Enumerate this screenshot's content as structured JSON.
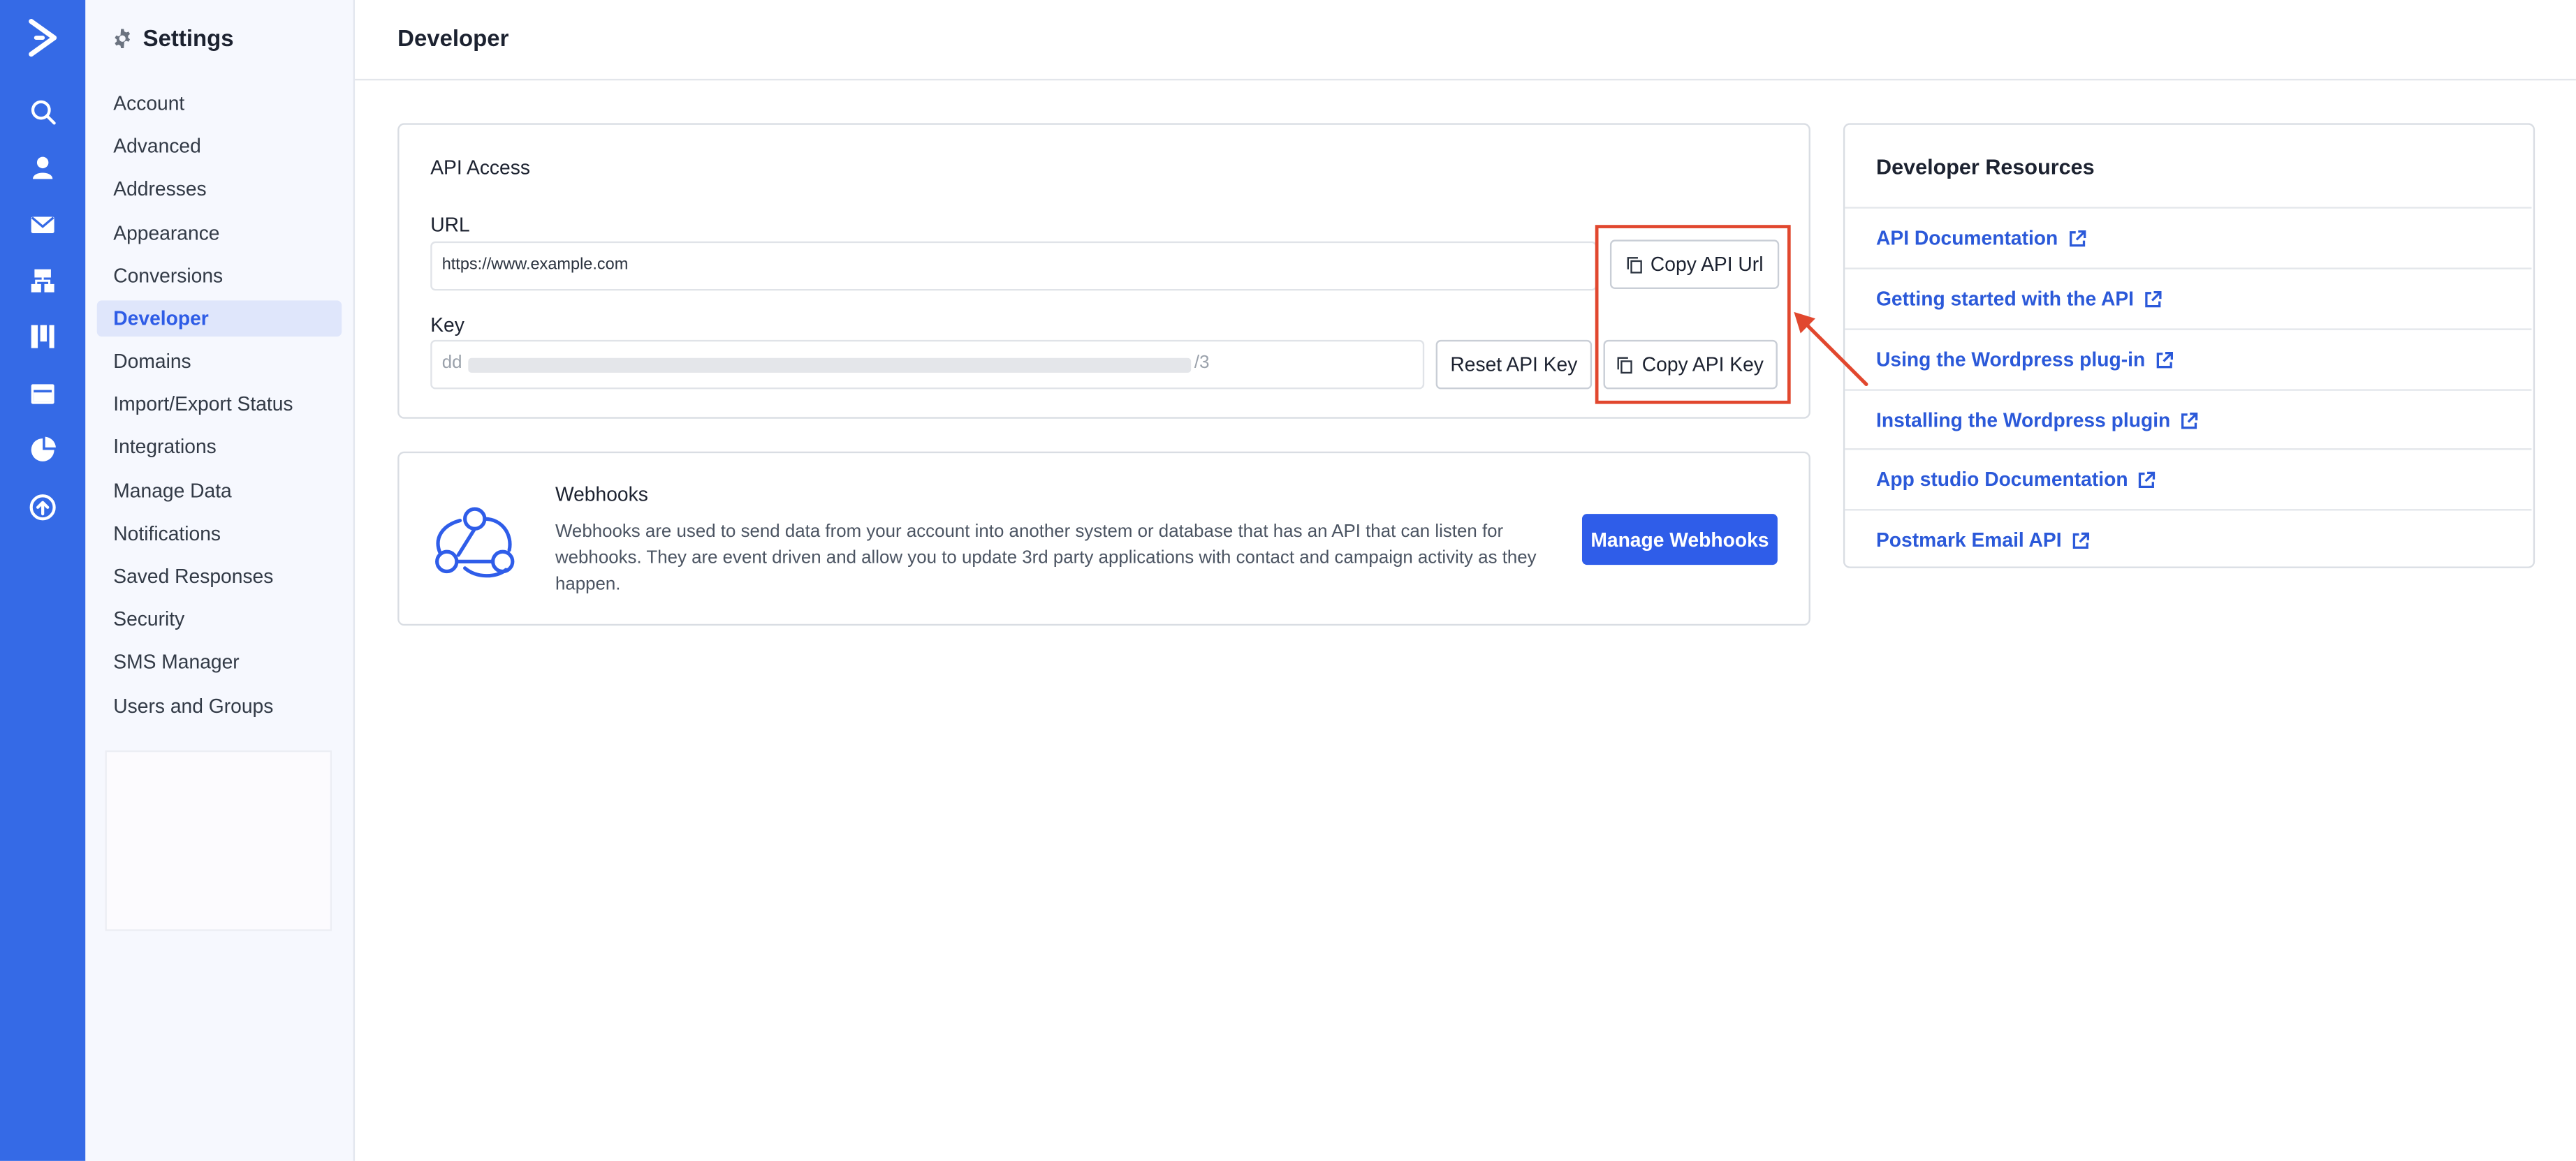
{
  "nav_rail": {
    "icons": [
      "logo-icon",
      "search-icon",
      "contacts-icon",
      "campaigns-icon",
      "automations-icon",
      "deals-icon",
      "website-icon",
      "reports-icon",
      "upgrade-icon"
    ]
  },
  "settings": {
    "title": "Settings",
    "items": [
      {
        "label": "Account"
      },
      {
        "label": "Advanced"
      },
      {
        "label": "Addresses"
      },
      {
        "label": "Appearance"
      },
      {
        "label": "Conversions"
      },
      {
        "label": "Developer",
        "active": true
      },
      {
        "label": "Domains"
      },
      {
        "label": "Import/Export Status"
      },
      {
        "label": "Integrations"
      },
      {
        "label": "Manage Data"
      },
      {
        "label": "Notifications"
      },
      {
        "label": "Saved Responses"
      },
      {
        "label": "Security"
      },
      {
        "label": "SMS Manager"
      },
      {
        "label": "Users and Groups"
      }
    ]
  },
  "page": {
    "title": "Developer"
  },
  "api_access": {
    "heading": "API Access",
    "url_label": "URL",
    "url_value": "https://www.example.com",
    "copy_url_button": "Copy API Url",
    "key_label": "Key",
    "key_prefix": "dd",
    "key_suffix": "/3",
    "reset_key_button": "Reset API Key",
    "copy_key_button": "Copy API Key"
  },
  "webhooks": {
    "heading": "Webhooks",
    "description": "Webhooks are used to send data from your account into another system or database that has an API that can listen for webhooks. They are event driven and allow you to update 3rd party applications with contact and campaign activity as they happen.",
    "manage_button": "Manage Webhooks"
  },
  "resources": {
    "heading": "Developer Resources",
    "links": [
      {
        "label": "API Documentation"
      },
      {
        "label": "Getting started with the API"
      },
      {
        "label": "Using the Wordpress plug-in"
      },
      {
        "label": "Installing the Wordpress plugin"
      },
      {
        "label": "App studio Documentation"
      },
      {
        "label": "Postmark Email API"
      }
    ]
  },
  "colors": {
    "brand": "#356ae6",
    "primary_button": "#2f5de9",
    "link": "#2b59d9",
    "annotation": "#e1472e"
  }
}
